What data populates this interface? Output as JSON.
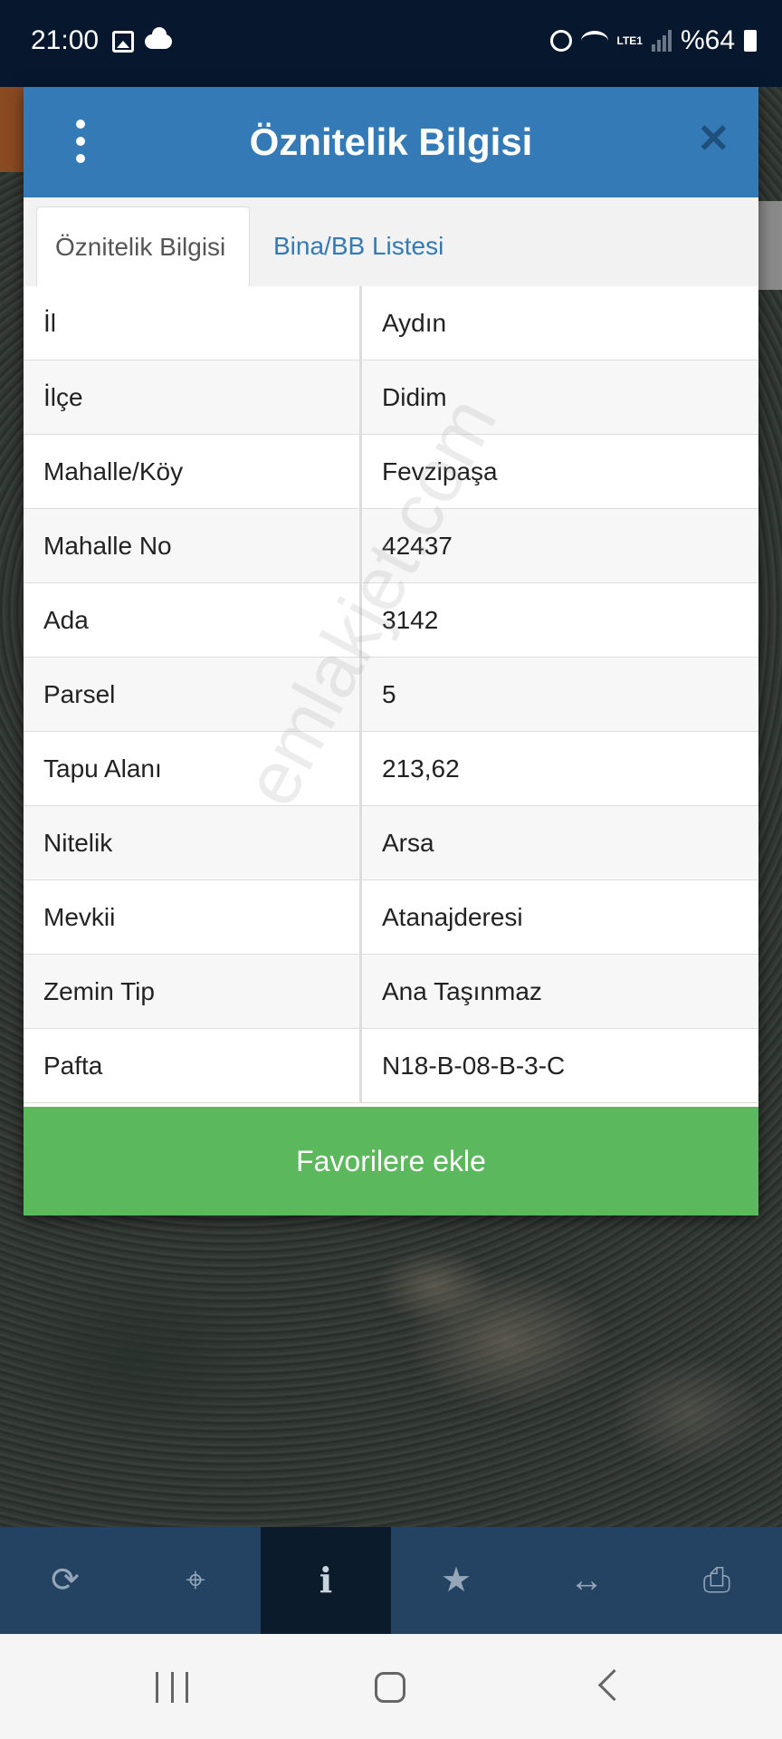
{
  "status_bar": {
    "time": "21:00",
    "battery": "%64",
    "network": "LTE1",
    "icons": [
      "gallery-icon",
      "cloud-icon",
      "alarm-icon",
      "wifi-icon",
      "signal-icon",
      "battery-icon"
    ]
  },
  "dialog": {
    "title": "Öznitelik Bilgisi",
    "menu_icon": "more-vertical-icon",
    "close_icon": "close-icon",
    "tabs": [
      {
        "label": "Öznitelik Bilgisi",
        "active": true
      },
      {
        "label": "Bina/BB Listesi",
        "active": false
      }
    ],
    "rows": [
      {
        "key": "İl",
        "value": "Aydın"
      },
      {
        "key": "İlçe",
        "value": "Didim"
      },
      {
        "key": "Mahalle/Köy",
        "value": "Fevzipaşa"
      },
      {
        "key": "Mahalle No",
        "value": "42437"
      },
      {
        "key": "Ada",
        "value": "3142"
      },
      {
        "key": "Parsel",
        "value": "5"
      },
      {
        "key": "Tapu Alanı",
        "value": "213,62"
      },
      {
        "key": "Nitelik",
        "value": "Arsa"
      },
      {
        "key": "Mevkii",
        "value": "Atanajderesi"
      },
      {
        "key": "Zemin Tip",
        "value": "Ana Taşınmaz"
      },
      {
        "key": "Pafta",
        "value": "N18-B-08-B-3-C"
      }
    ],
    "favorite_button": "Favorilere ekle"
  },
  "watermark": "emlakjet.com",
  "toolbar": {
    "items": [
      {
        "icon": "refresh-icon",
        "active": false
      },
      {
        "icon": "locate-icon",
        "active": false
      },
      {
        "icon": "info-icon",
        "active": true
      },
      {
        "icon": "star-icon",
        "active": false
      },
      {
        "icon": "measure-icon",
        "active": false
      },
      {
        "icon": "print-icon",
        "active": false
      }
    ]
  },
  "colors": {
    "header": "#337ab7",
    "button": "#5cb85c",
    "toolbar": "#244262",
    "statusbar": "#07182e"
  }
}
